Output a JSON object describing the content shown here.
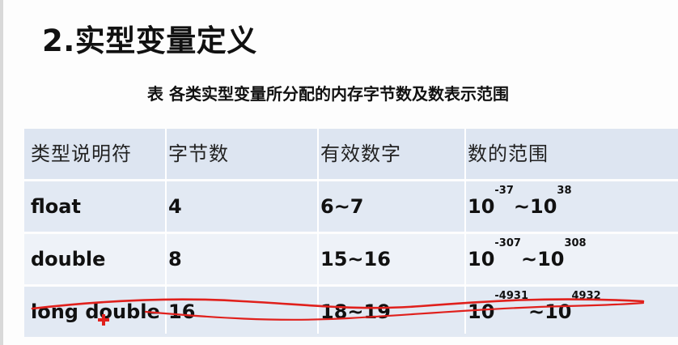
{
  "slide": {
    "heading": "2.实型变量定义",
    "caption": "表 各类实型变量所分配的内存字节数及数表示范围"
  },
  "table": {
    "columns": [
      "类型说明符",
      "字节数",
      "有效数字",
      "数的范围"
    ],
    "rows": [
      {
        "type": "float",
        "bytes": "4",
        "digits": "6~7",
        "range": {
          "base1": "10",
          "exp1": "-37",
          "sep": "~",
          "base2": "10",
          "exp2": "38"
        }
      },
      {
        "type": "double",
        "bytes": "8",
        "digits": "15~16",
        "range": {
          "base1": "10",
          "exp1": "-307",
          "sep": "~",
          "base2": "10",
          "exp2": "308"
        }
      },
      {
        "type": "long double",
        "bytes": "16",
        "digits": "18~19",
        "range": {
          "base1": "10",
          "exp1": "-4931",
          "sep": "~",
          "base2": "10",
          "exp2": "4932"
        }
      }
    ]
  },
  "annotation": {
    "pen_color": "#e0201c",
    "cursor_icon": "red-plus-cursor-icon"
  }
}
